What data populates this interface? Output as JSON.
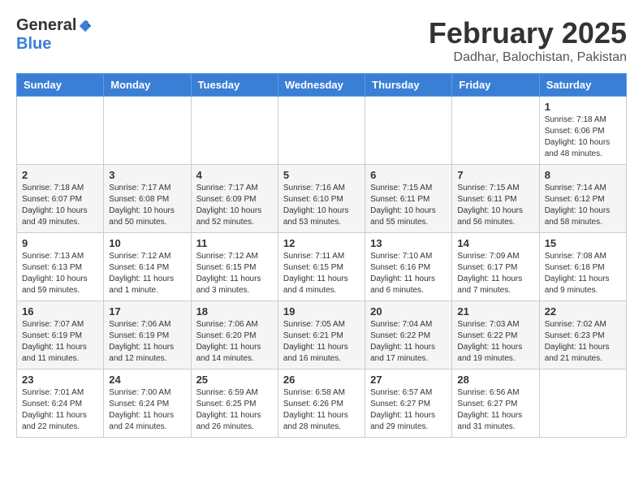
{
  "header": {
    "logo_general": "General",
    "logo_blue": "Blue",
    "month_title": "February 2025",
    "location": "Dadhar, Balochistan, Pakistan"
  },
  "calendar": {
    "days_of_week": [
      "Sunday",
      "Monday",
      "Tuesday",
      "Wednesday",
      "Thursday",
      "Friday",
      "Saturday"
    ],
    "weeks": [
      [
        {
          "day": "",
          "info": ""
        },
        {
          "day": "",
          "info": ""
        },
        {
          "day": "",
          "info": ""
        },
        {
          "day": "",
          "info": ""
        },
        {
          "day": "",
          "info": ""
        },
        {
          "day": "",
          "info": ""
        },
        {
          "day": "1",
          "info": "Sunrise: 7:18 AM\nSunset: 6:06 PM\nDaylight: 10 hours and 48 minutes."
        }
      ],
      [
        {
          "day": "2",
          "info": "Sunrise: 7:18 AM\nSunset: 6:07 PM\nDaylight: 10 hours and 49 minutes."
        },
        {
          "day": "3",
          "info": "Sunrise: 7:17 AM\nSunset: 6:08 PM\nDaylight: 10 hours and 50 minutes."
        },
        {
          "day": "4",
          "info": "Sunrise: 7:17 AM\nSunset: 6:09 PM\nDaylight: 10 hours and 52 minutes."
        },
        {
          "day": "5",
          "info": "Sunrise: 7:16 AM\nSunset: 6:10 PM\nDaylight: 10 hours and 53 minutes."
        },
        {
          "day": "6",
          "info": "Sunrise: 7:15 AM\nSunset: 6:11 PM\nDaylight: 10 hours and 55 minutes."
        },
        {
          "day": "7",
          "info": "Sunrise: 7:15 AM\nSunset: 6:11 PM\nDaylight: 10 hours and 56 minutes."
        },
        {
          "day": "8",
          "info": "Sunrise: 7:14 AM\nSunset: 6:12 PM\nDaylight: 10 hours and 58 minutes."
        }
      ],
      [
        {
          "day": "9",
          "info": "Sunrise: 7:13 AM\nSunset: 6:13 PM\nDaylight: 10 hours and 59 minutes."
        },
        {
          "day": "10",
          "info": "Sunrise: 7:12 AM\nSunset: 6:14 PM\nDaylight: 11 hours and 1 minute."
        },
        {
          "day": "11",
          "info": "Sunrise: 7:12 AM\nSunset: 6:15 PM\nDaylight: 11 hours and 3 minutes."
        },
        {
          "day": "12",
          "info": "Sunrise: 7:11 AM\nSunset: 6:15 PM\nDaylight: 11 hours and 4 minutes."
        },
        {
          "day": "13",
          "info": "Sunrise: 7:10 AM\nSunset: 6:16 PM\nDaylight: 11 hours and 6 minutes."
        },
        {
          "day": "14",
          "info": "Sunrise: 7:09 AM\nSunset: 6:17 PM\nDaylight: 11 hours and 7 minutes."
        },
        {
          "day": "15",
          "info": "Sunrise: 7:08 AM\nSunset: 6:18 PM\nDaylight: 11 hours and 9 minutes."
        }
      ],
      [
        {
          "day": "16",
          "info": "Sunrise: 7:07 AM\nSunset: 6:19 PM\nDaylight: 11 hours and 11 minutes."
        },
        {
          "day": "17",
          "info": "Sunrise: 7:06 AM\nSunset: 6:19 PM\nDaylight: 11 hours and 12 minutes."
        },
        {
          "day": "18",
          "info": "Sunrise: 7:06 AM\nSunset: 6:20 PM\nDaylight: 11 hours and 14 minutes."
        },
        {
          "day": "19",
          "info": "Sunrise: 7:05 AM\nSunset: 6:21 PM\nDaylight: 11 hours and 16 minutes."
        },
        {
          "day": "20",
          "info": "Sunrise: 7:04 AM\nSunset: 6:22 PM\nDaylight: 11 hours and 17 minutes."
        },
        {
          "day": "21",
          "info": "Sunrise: 7:03 AM\nSunset: 6:22 PM\nDaylight: 11 hours and 19 minutes."
        },
        {
          "day": "22",
          "info": "Sunrise: 7:02 AM\nSunset: 6:23 PM\nDaylight: 11 hours and 21 minutes."
        }
      ],
      [
        {
          "day": "23",
          "info": "Sunrise: 7:01 AM\nSunset: 6:24 PM\nDaylight: 11 hours and 22 minutes."
        },
        {
          "day": "24",
          "info": "Sunrise: 7:00 AM\nSunset: 6:24 PM\nDaylight: 11 hours and 24 minutes."
        },
        {
          "day": "25",
          "info": "Sunrise: 6:59 AM\nSunset: 6:25 PM\nDaylight: 11 hours and 26 minutes."
        },
        {
          "day": "26",
          "info": "Sunrise: 6:58 AM\nSunset: 6:26 PM\nDaylight: 11 hours and 28 minutes."
        },
        {
          "day": "27",
          "info": "Sunrise: 6:57 AM\nSunset: 6:27 PM\nDaylight: 11 hours and 29 minutes."
        },
        {
          "day": "28",
          "info": "Sunrise: 6:56 AM\nSunset: 6:27 PM\nDaylight: 11 hours and 31 minutes."
        },
        {
          "day": "",
          "info": ""
        }
      ]
    ]
  }
}
